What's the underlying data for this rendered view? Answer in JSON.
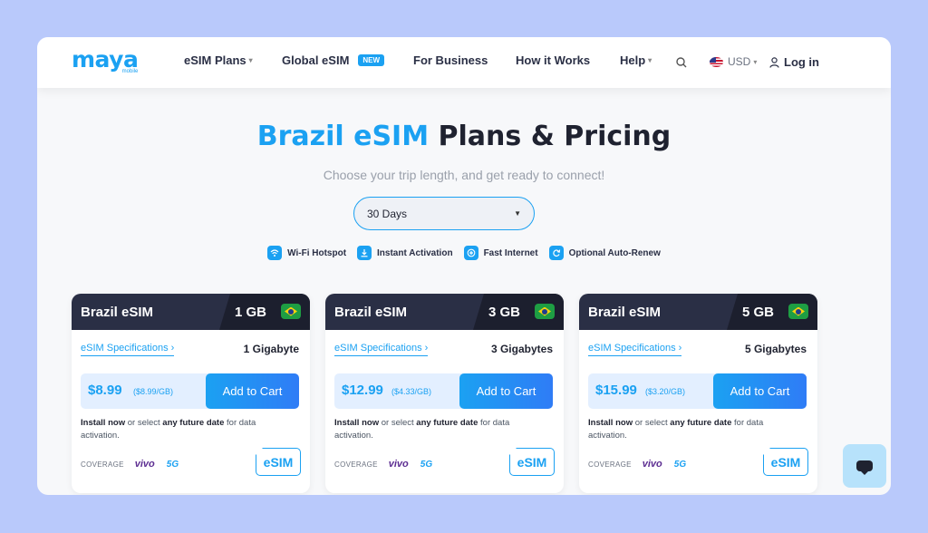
{
  "brand": {
    "name": "maya",
    "sub": "mobile"
  },
  "nav": {
    "esim_plans": "eSIM Plans",
    "global_esim": "Global eSIM",
    "new_badge": "NEW",
    "for_business": "For Business",
    "how_it_works": "How it Works",
    "help": "Help",
    "currency": "USD",
    "login": "Log in"
  },
  "hero": {
    "title_accent": "Brazil eSIM",
    "title_rest": " Plans & Pricing",
    "subtitle": "Choose your trip length, and get ready to connect!",
    "duration_selected": "30 Days"
  },
  "features": [
    {
      "label": "Wi-Fi Hotspot",
      "icon": "wifi-icon"
    },
    {
      "label": "Instant Activation",
      "icon": "download-icon"
    },
    {
      "label": "Fast Internet",
      "icon": "speed-icon"
    },
    {
      "label": "Optional Auto-Renew",
      "icon": "renew-icon"
    }
  ],
  "cards": [
    {
      "name": "Brazil eSIM",
      "gb": "1 GB",
      "specs_link": "eSIM Specifications ›",
      "specs_value": "1 Gigabyte",
      "price": "$8.99",
      "per_gb": "($8.99/GB)",
      "cart": "Add to Cart",
      "install_a": "Install now",
      "install_b": " or select ",
      "install_c": "any future date",
      "install_d": " for data activation.",
      "coverage": "COVERAGE",
      "carrier": "vivo",
      "network": "5G",
      "badge": "eSIM"
    },
    {
      "name": "Brazil eSIM",
      "gb": "3 GB",
      "specs_link": "eSIM Specifications ›",
      "specs_value": "3 Gigabytes",
      "price": "$12.99",
      "per_gb": "($4.33/GB)",
      "cart": "Add to Cart",
      "install_a": "Install now",
      "install_b": " or select ",
      "install_c": "any future date",
      "install_d": " for data activation.",
      "coverage": "COVERAGE",
      "carrier": "vivo",
      "network": "5G",
      "badge": "eSIM"
    },
    {
      "name": "Brazil eSIM",
      "gb": "5 GB",
      "specs_link": "eSIM Specifications ›",
      "specs_value": "5 Gigabytes",
      "price": "$15.99",
      "per_gb": "($3.20/GB)",
      "cart": "Add to Cart",
      "install_a": "Install now",
      "install_b": " or select ",
      "install_c": "any future date",
      "install_d": " for data activation.",
      "coverage": "COVERAGE",
      "carrier": "vivo",
      "network": "5G",
      "badge": "eSIM"
    }
  ],
  "colors": {
    "accent": "#1ba1f2",
    "dark": "#2a2f45",
    "backdrop": "#b9c9fb"
  }
}
